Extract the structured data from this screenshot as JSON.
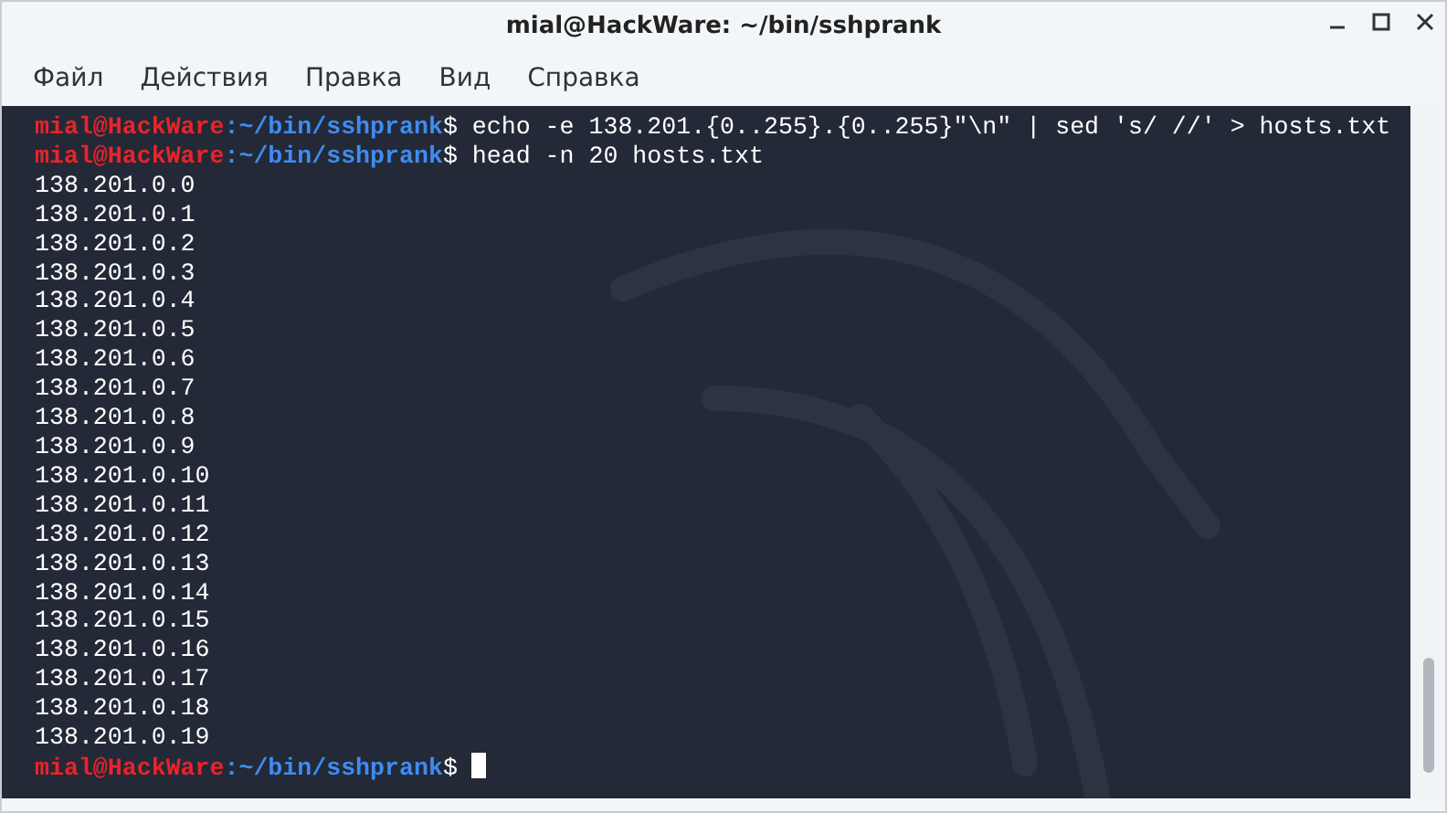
{
  "window": {
    "title": "mial@HackWare: ~/bin/sshprank"
  },
  "menu": [
    "Файл",
    "Действия",
    "Правка",
    "Вид",
    "Справка"
  ],
  "terminal": {
    "lines": [
      {
        "kind": "prompt",
        "user": "mial@HackWare",
        "path": ":~/bin/sshprank",
        "symbol": "$",
        "command": "echo -e 138.201.{0..255}.{0..255}\"\\n\" | sed 's/ //' > hosts.txt"
      },
      {
        "kind": "prompt",
        "user": "mial@HackWare",
        "path": ":~/bin/sshprank",
        "symbol": "$",
        "command": "head -n 20 hosts.txt"
      },
      {
        "kind": "output",
        "text": "138.201.0.0"
      },
      {
        "kind": "output",
        "text": "138.201.0.1"
      },
      {
        "kind": "output",
        "text": "138.201.0.2"
      },
      {
        "kind": "output",
        "text": "138.201.0.3"
      },
      {
        "kind": "output",
        "text": "138.201.0.4"
      },
      {
        "kind": "output",
        "text": "138.201.0.5"
      },
      {
        "kind": "output",
        "text": "138.201.0.6"
      },
      {
        "kind": "output",
        "text": "138.201.0.7"
      },
      {
        "kind": "output",
        "text": "138.201.0.8"
      },
      {
        "kind": "output",
        "text": "138.201.0.9"
      },
      {
        "kind": "output",
        "text": "138.201.0.10"
      },
      {
        "kind": "output",
        "text": "138.201.0.11"
      },
      {
        "kind": "output",
        "text": "138.201.0.12"
      },
      {
        "kind": "output",
        "text": "138.201.0.13"
      },
      {
        "kind": "output",
        "text": "138.201.0.14"
      },
      {
        "kind": "output",
        "text": "138.201.0.15"
      },
      {
        "kind": "output",
        "text": "138.201.0.16"
      },
      {
        "kind": "output",
        "text": "138.201.0.17"
      },
      {
        "kind": "output",
        "text": "138.201.0.18"
      },
      {
        "kind": "output",
        "text": "138.201.0.19"
      },
      {
        "kind": "prompt",
        "user": "mial@HackWare",
        "path": ":~/bin/sshprank",
        "symbol": "$",
        "cursor": true
      }
    ]
  }
}
